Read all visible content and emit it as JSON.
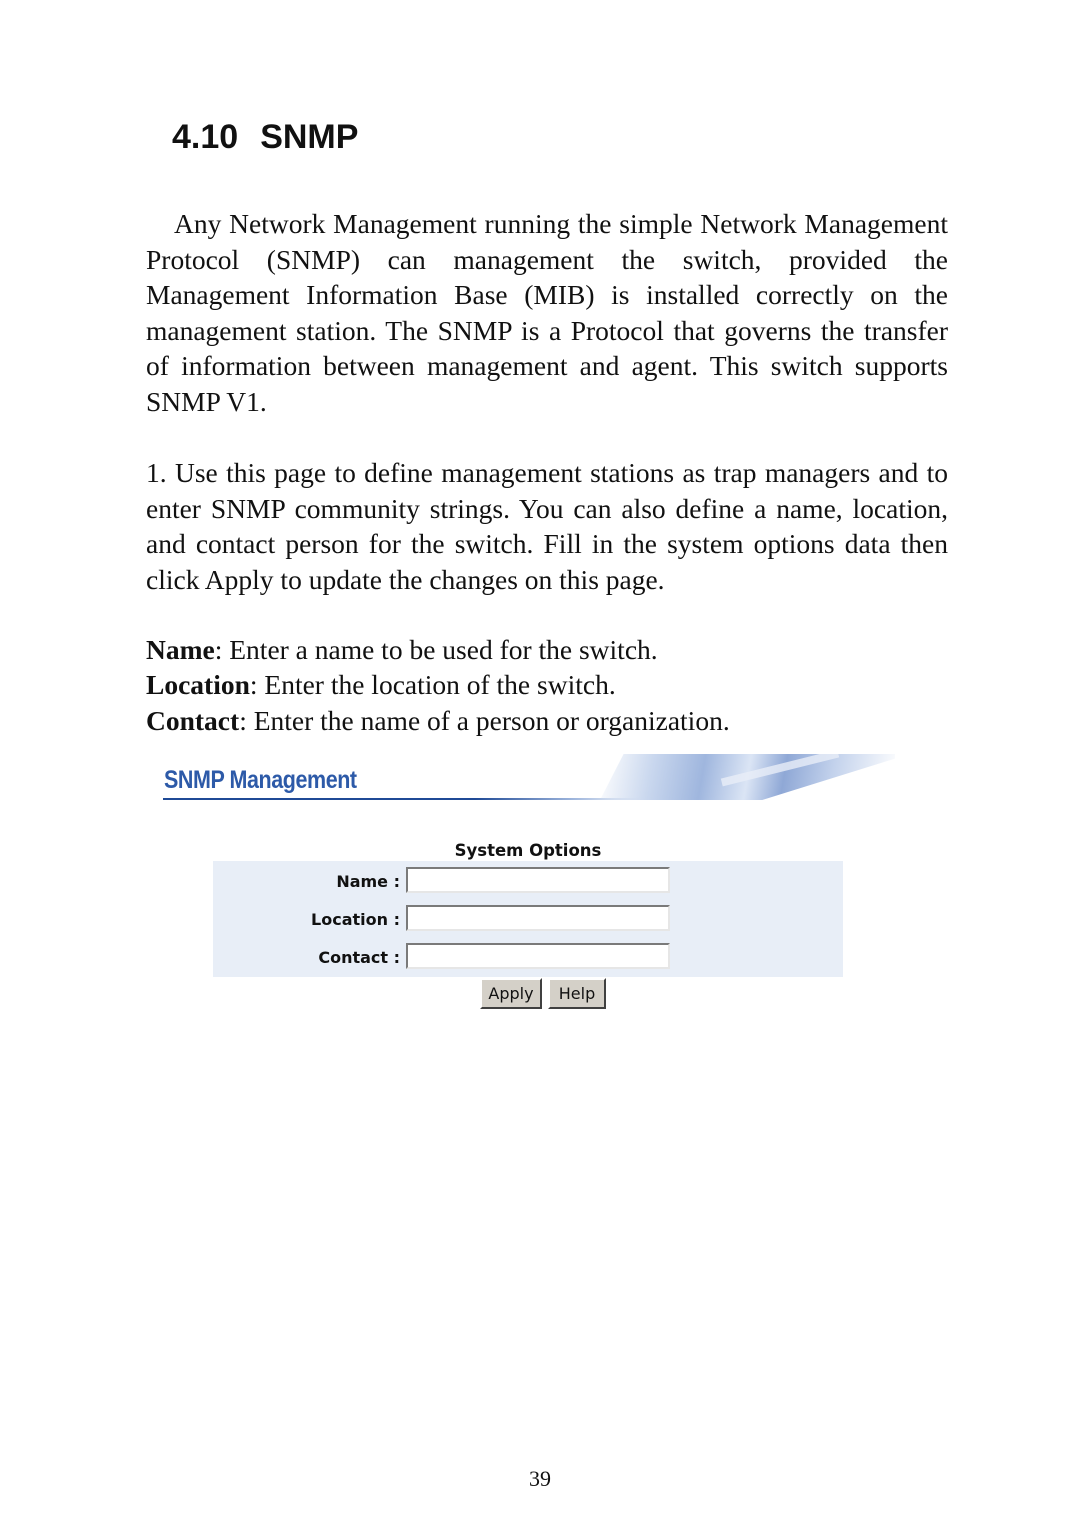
{
  "section": {
    "number": "4.10",
    "title": "SNMP"
  },
  "paragraphs": {
    "intro": "Any Network Management running the simple Network Management Protocol (SNMP) can management the switch, provided the Management Information Base (MIB) is installed correctly on the management station. The SNMP is a Protocol that governs the transfer of information between management and agent. This switch supports SNMP V1.",
    "step1": "1. Use this page to define management stations as trap managers and to enter SNMP community strings. You can also define a name, location, and contact person for the switch. Fill in the system options data then click Apply to update the changes on this page."
  },
  "definitions": [
    {
      "term": "Name",
      "text": ": Enter a name to be used for the switch."
    },
    {
      "term": "Location",
      "text": ": Enter the location of the switch."
    },
    {
      "term": "Contact",
      "text": ": Enter the name of a person or organization."
    }
  ],
  "screenshot": {
    "banner_title": "SNMP Management",
    "options_title": "System Options",
    "fields": [
      {
        "label": "Name :",
        "value": ""
      },
      {
        "label": "Location :",
        "value": ""
      },
      {
        "label": "Contact :",
        "value": ""
      }
    ],
    "buttons": {
      "apply": "Apply",
      "help": "Help"
    }
  },
  "page_number": "39"
}
